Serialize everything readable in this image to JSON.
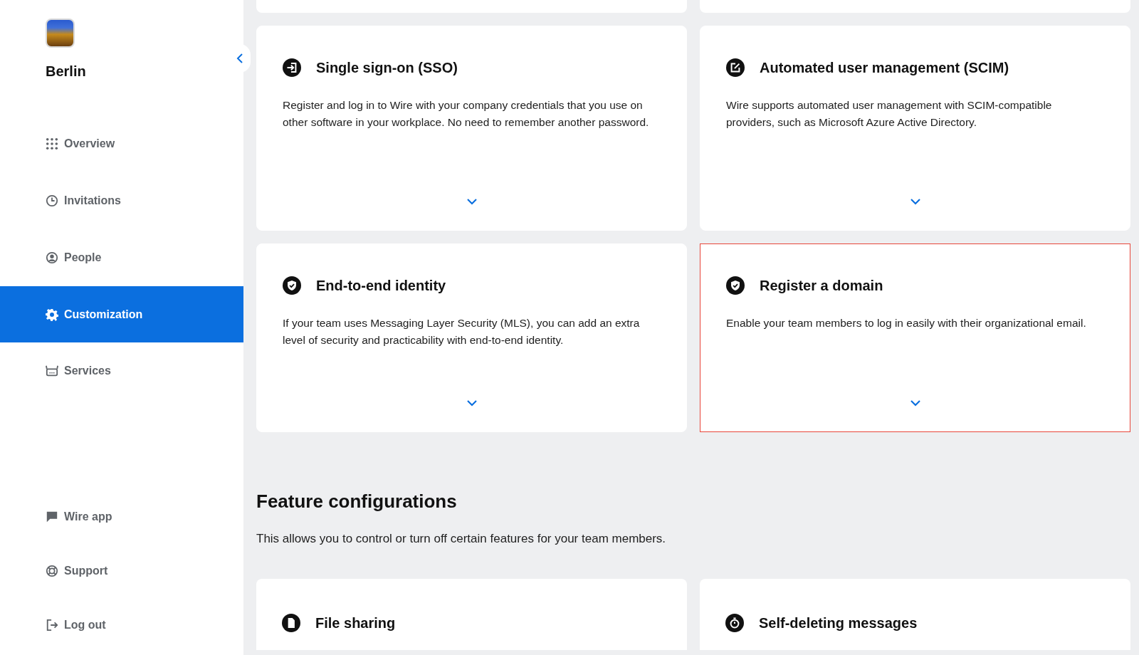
{
  "team": {
    "name": "Berlin"
  },
  "sidebar": {
    "items": [
      {
        "label": "Overview",
        "kind": "grid",
        "selected": false
      },
      {
        "label": "Invitations",
        "kind": "clock",
        "selected": false
      },
      {
        "label": "People",
        "kind": "person",
        "selected": false
      },
      {
        "label": "Customization",
        "kind": "gear",
        "selected": true
      },
      {
        "label": "Services",
        "kind": "bot",
        "selected": false
      }
    ],
    "bottom_items": [
      {
        "label": "Wire app",
        "kind": "chat"
      },
      {
        "label": "Support",
        "kind": "lifebuoy"
      },
      {
        "label": "Log out",
        "kind": "logout"
      }
    ]
  },
  "cards": [
    {
      "kind": "signin",
      "title": "Single sign-on (SSO)",
      "description": "Register and log in to Wire with your company credentials that you use on other software in your workplace. No need to remember another password.",
      "highlighted": false
    },
    {
      "kind": "edit",
      "title": "Automated user management (SCIM)",
      "description": "Wire supports automated user management with SCIM-compatible providers, such as Microsoft Azure Active Directory.",
      "highlighted": false
    },
    {
      "kind": "shield",
      "title": "End-to-end identity",
      "description": "If your team uses Messaging Layer Security (MLS), you can add an extra level of security and practicability with end-to-end identity.",
      "highlighted": false
    },
    {
      "kind": "shield",
      "title": "Register a domain",
      "description": "Enable your team members to log in easily with their organizational email.",
      "highlighted": true
    }
  ],
  "feature_configurations": {
    "title": "Feature configurations",
    "description": "This allows you to control or turn off certain features for your team members.",
    "cards": [
      {
        "kind": "file",
        "title": "File sharing"
      },
      {
        "kind": "timer",
        "title": "Self-deleting messages"
      }
    ]
  }
}
